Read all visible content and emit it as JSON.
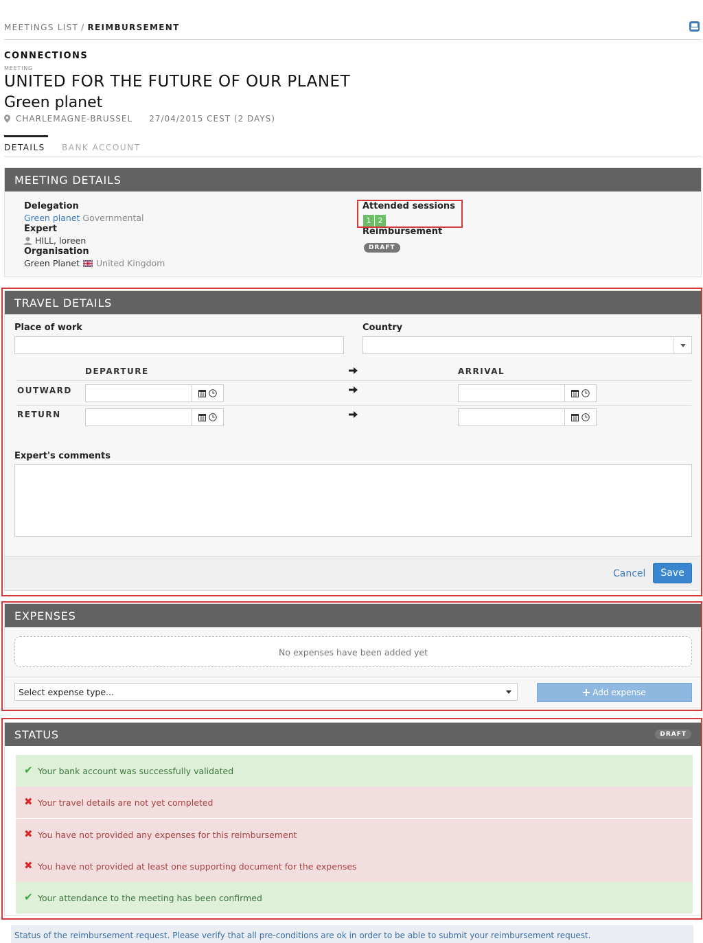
{
  "breadcrumb": {
    "parent": "MEETINGS LIST",
    "separator": "/",
    "current": "REIMBURSEMENT"
  },
  "header": {
    "eyebrow": "CONNECTIONS",
    "tiny": "MEETING",
    "title": "UNITED FOR THE FUTURE OF OUR PLANET",
    "subtitle": "Green planet",
    "location": "CHARLEMAGNE-BRUSSEL",
    "date": "27/04/2015 CEST (2 DAYS)"
  },
  "tabs": [
    {
      "label": "DETAILS"
    },
    {
      "label": "BANK ACCOUNT"
    }
  ],
  "meeting_details": {
    "title": "MEETING DETAILS",
    "delegation_label": "Delegation",
    "delegation_name": "Green planet",
    "delegation_type": "Governmental",
    "expert_label": "Expert",
    "expert_name": "HILL, loreen",
    "organisation_label": "Organisation",
    "organisation_name": "Green Planet",
    "organisation_country": "United Kingdom",
    "attended_label": "Attended sessions",
    "sessions": [
      "1",
      "2"
    ],
    "reimbursement_label": "Reimbursement",
    "reimbursement_status": "DRAFT"
  },
  "travel": {
    "title": "TRAVEL DETAILS",
    "place_label": "Place of work",
    "country_label": "Country",
    "departure_header": "DEPARTURE",
    "arrival_header": "ARRIVAL",
    "outward_label": "OUTWARD",
    "return_label": "RETURN",
    "comments_label": "Expert's comments",
    "cancel_label": "Cancel",
    "save_label": "Save"
  },
  "expenses": {
    "title": "EXPENSES",
    "empty_text": "No expenses have been added yet",
    "select_placeholder": "Select expense type...",
    "add_label": "Add expense"
  },
  "status": {
    "title": "STATUS",
    "badge": "DRAFT",
    "items": [
      {
        "state": "ok",
        "text": "Your bank account was successfully validated"
      },
      {
        "state": "bad",
        "text": "Your travel details are not yet completed"
      },
      {
        "state": "bad",
        "text": "You have not provided any expenses for this reimbursement"
      },
      {
        "state": "bad",
        "text": "You have not provided at least one supporting document for the expenses"
      },
      {
        "state": "ok",
        "text": "Your attendance to the meeting has been confirmed"
      }
    ],
    "footer": "Status of the reimbursement request. Please verify that all pre-conditions are ok in order to be able to submit your reimbursement request."
  },
  "colors": {
    "header_bar": "#626262",
    "accent": "#3a87d0",
    "highlight": "#d53a3a",
    "success_bg": "#dff0d8",
    "error_bg": "#f2dede"
  },
  "icons": [
    "inbox-icon",
    "map-pin-icon",
    "user-icon",
    "uk-flag-icon",
    "caret-down-icon",
    "calendar-icon",
    "clock-icon",
    "arrow-right-icon",
    "plus-icon",
    "check-icon",
    "cross-icon"
  ]
}
